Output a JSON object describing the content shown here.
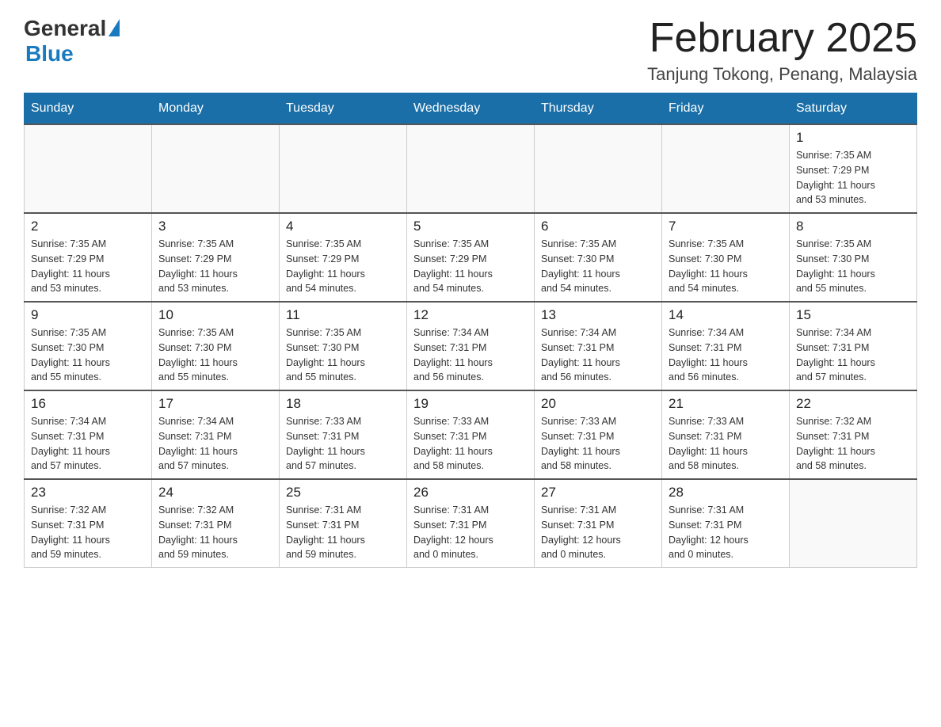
{
  "header": {
    "logo_general": "General",
    "logo_blue": "Blue",
    "month_year": "February 2025",
    "location": "Tanjung Tokong, Penang, Malaysia"
  },
  "weekdays": [
    "Sunday",
    "Monday",
    "Tuesday",
    "Wednesday",
    "Thursday",
    "Friday",
    "Saturday"
  ],
  "weeks": [
    [
      {
        "day": "",
        "info": ""
      },
      {
        "day": "",
        "info": ""
      },
      {
        "day": "",
        "info": ""
      },
      {
        "day": "",
        "info": ""
      },
      {
        "day": "",
        "info": ""
      },
      {
        "day": "",
        "info": ""
      },
      {
        "day": "1",
        "info": "Sunrise: 7:35 AM\nSunset: 7:29 PM\nDaylight: 11 hours\nand 53 minutes."
      }
    ],
    [
      {
        "day": "2",
        "info": "Sunrise: 7:35 AM\nSunset: 7:29 PM\nDaylight: 11 hours\nand 53 minutes."
      },
      {
        "day": "3",
        "info": "Sunrise: 7:35 AM\nSunset: 7:29 PM\nDaylight: 11 hours\nand 53 minutes."
      },
      {
        "day": "4",
        "info": "Sunrise: 7:35 AM\nSunset: 7:29 PM\nDaylight: 11 hours\nand 54 minutes."
      },
      {
        "day": "5",
        "info": "Sunrise: 7:35 AM\nSunset: 7:29 PM\nDaylight: 11 hours\nand 54 minutes."
      },
      {
        "day": "6",
        "info": "Sunrise: 7:35 AM\nSunset: 7:30 PM\nDaylight: 11 hours\nand 54 minutes."
      },
      {
        "day": "7",
        "info": "Sunrise: 7:35 AM\nSunset: 7:30 PM\nDaylight: 11 hours\nand 54 minutes."
      },
      {
        "day": "8",
        "info": "Sunrise: 7:35 AM\nSunset: 7:30 PM\nDaylight: 11 hours\nand 55 minutes."
      }
    ],
    [
      {
        "day": "9",
        "info": "Sunrise: 7:35 AM\nSunset: 7:30 PM\nDaylight: 11 hours\nand 55 minutes."
      },
      {
        "day": "10",
        "info": "Sunrise: 7:35 AM\nSunset: 7:30 PM\nDaylight: 11 hours\nand 55 minutes."
      },
      {
        "day": "11",
        "info": "Sunrise: 7:35 AM\nSunset: 7:30 PM\nDaylight: 11 hours\nand 55 minutes."
      },
      {
        "day": "12",
        "info": "Sunrise: 7:34 AM\nSunset: 7:31 PM\nDaylight: 11 hours\nand 56 minutes."
      },
      {
        "day": "13",
        "info": "Sunrise: 7:34 AM\nSunset: 7:31 PM\nDaylight: 11 hours\nand 56 minutes."
      },
      {
        "day": "14",
        "info": "Sunrise: 7:34 AM\nSunset: 7:31 PM\nDaylight: 11 hours\nand 56 minutes."
      },
      {
        "day": "15",
        "info": "Sunrise: 7:34 AM\nSunset: 7:31 PM\nDaylight: 11 hours\nand 57 minutes."
      }
    ],
    [
      {
        "day": "16",
        "info": "Sunrise: 7:34 AM\nSunset: 7:31 PM\nDaylight: 11 hours\nand 57 minutes."
      },
      {
        "day": "17",
        "info": "Sunrise: 7:34 AM\nSunset: 7:31 PM\nDaylight: 11 hours\nand 57 minutes."
      },
      {
        "day": "18",
        "info": "Sunrise: 7:33 AM\nSunset: 7:31 PM\nDaylight: 11 hours\nand 57 minutes."
      },
      {
        "day": "19",
        "info": "Sunrise: 7:33 AM\nSunset: 7:31 PM\nDaylight: 11 hours\nand 58 minutes."
      },
      {
        "day": "20",
        "info": "Sunrise: 7:33 AM\nSunset: 7:31 PM\nDaylight: 11 hours\nand 58 minutes."
      },
      {
        "day": "21",
        "info": "Sunrise: 7:33 AM\nSunset: 7:31 PM\nDaylight: 11 hours\nand 58 minutes."
      },
      {
        "day": "22",
        "info": "Sunrise: 7:32 AM\nSunset: 7:31 PM\nDaylight: 11 hours\nand 58 minutes."
      }
    ],
    [
      {
        "day": "23",
        "info": "Sunrise: 7:32 AM\nSunset: 7:31 PM\nDaylight: 11 hours\nand 59 minutes."
      },
      {
        "day": "24",
        "info": "Sunrise: 7:32 AM\nSunset: 7:31 PM\nDaylight: 11 hours\nand 59 minutes."
      },
      {
        "day": "25",
        "info": "Sunrise: 7:31 AM\nSunset: 7:31 PM\nDaylight: 11 hours\nand 59 minutes."
      },
      {
        "day": "26",
        "info": "Sunrise: 7:31 AM\nSunset: 7:31 PM\nDaylight: 12 hours\nand 0 minutes."
      },
      {
        "day": "27",
        "info": "Sunrise: 7:31 AM\nSunset: 7:31 PM\nDaylight: 12 hours\nand 0 minutes."
      },
      {
        "day": "28",
        "info": "Sunrise: 7:31 AM\nSunset: 7:31 PM\nDaylight: 12 hours\nand 0 minutes."
      },
      {
        "day": "",
        "info": ""
      }
    ]
  ]
}
